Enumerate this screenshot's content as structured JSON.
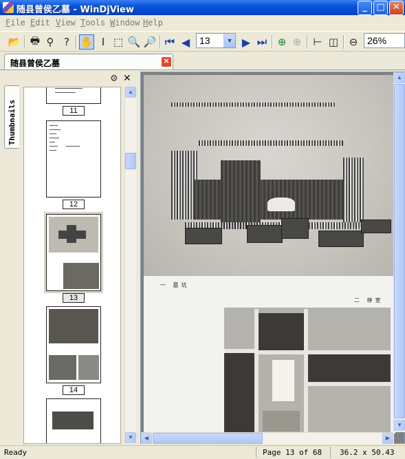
{
  "window": {
    "title": "随县曾侯乙墓 - WinDjView"
  },
  "menu": [
    "File",
    "Edit",
    "View",
    "Tools",
    "Window",
    "Help"
  ],
  "toolbar": {
    "page_value": "13",
    "zoom_value": "26%"
  },
  "document_tab": {
    "label": "随县曾侯乙墓"
  },
  "side_panel": {
    "tab_label": "Thumbnails",
    "thumbnails": [
      {
        "label": "11"
      },
      {
        "label": "12"
      },
      {
        "label": "13",
        "selected": true
      },
      {
        "label": "14"
      }
    ]
  },
  "page_captions": {
    "top": "一 墓坑",
    "bottom": "二 椁室"
  },
  "status": {
    "ready": "Ready",
    "page": "Page 13 of 68",
    "size": "36.2 x 50.43"
  },
  "colors": {
    "titlebar": "#0a55d8",
    "chrome": "#ece9d8",
    "selection": "#c1d2ee"
  }
}
